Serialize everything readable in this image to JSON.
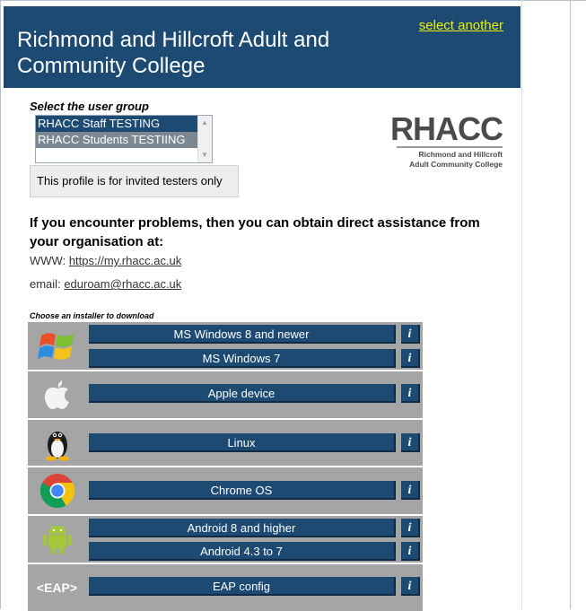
{
  "header": {
    "title": "Richmond and Hillcroft Adult and Community College",
    "select_another": "select another"
  },
  "user_group": {
    "label": "Select the user group",
    "options": [
      "RHACC Staff TESTING",
      "RHACC Students TESTIING"
    ],
    "note": "This profile is for invited testers only"
  },
  "logo": {
    "big": "RHACC",
    "line1": "Richmond and Hillcroft",
    "line2": "Adult Community College"
  },
  "help": {
    "heading": "If you encounter problems, then you can obtain direct assistance from your organisation at:",
    "www_label": "WWW:",
    "www_link": "https://my.rhacc.ac.uk",
    "email_label": "email:",
    "email_link": "eduroam@rhacc.ac.uk"
  },
  "installers": {
    "label": "Choose an installer to download",
    "info_label": "i",
    "groups": [
      {
        "icon": "windows-icon",
        "items": [
          "MS Windows 8 and newer",
          "MS Windows 7"
        ]
      },
      {
        "icon": "apple-icon",
        "items": [
          "Apple device"
        ]
      },
      {
        "icon": "linux-icon",
        "items": [
          "Linux"
        ]
      },
      {
        "icon": "chrome-icon",
        "items": [
          "Chrome OS"
        ]
      },
      {
        "icon": "android-icon",
        "items": [
          "Android 8 and higher",
          "Android 4.3 to 7"
        ]
      },
      {
        "icon": "eap-icon",
        "icon_text": "<EAP>",
        "items": [
          "EAP config"
        ]
      }
    ]
  },
  "colors": {
    "header_bg": "#1c4a72",
    "link_yellow": "#f0f000",
    "button_bg": "#1c4a72",
    "row_bg": "#a5a5a5"
  }
}
